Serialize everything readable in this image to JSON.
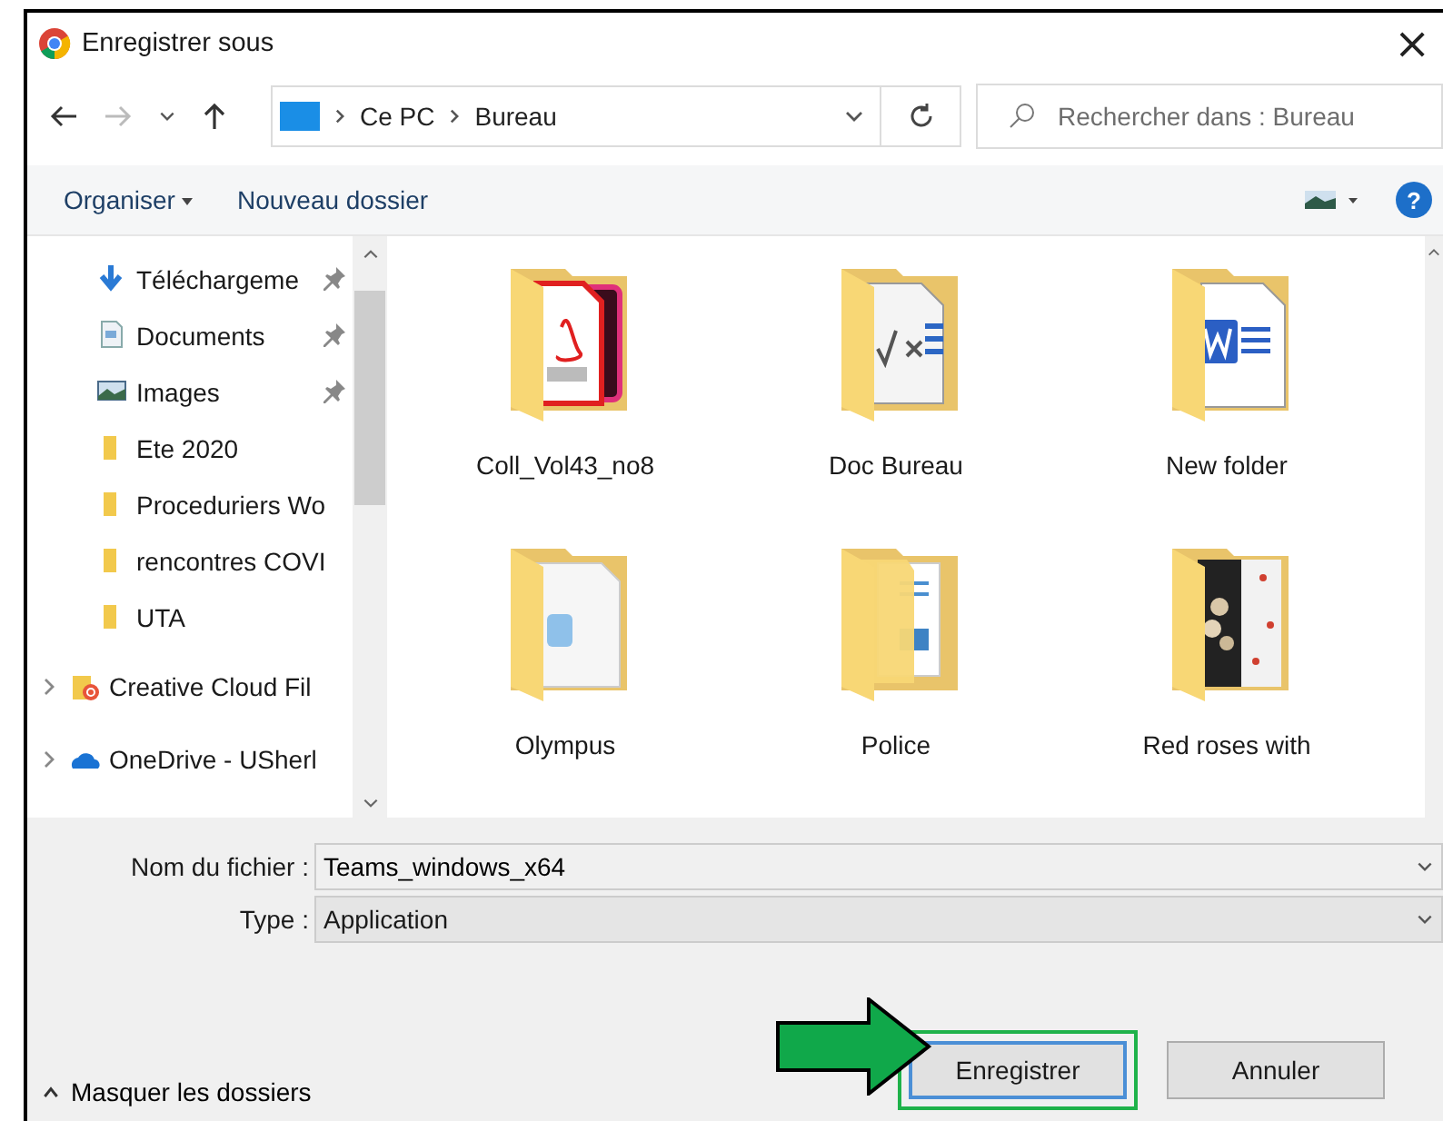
{
  "window": {
    "title": "Enregistrer sous",
    "close": "×"
  },
  "nav": {
    "breadcrumb": [
      "Ce PC",
      "Bureau"
    ],
    "search_placeholder": "Rechercher dans : Bureau"
  },
  "toolbar": {
    "organize": "Organiser",
    "new_folder": "Nouveau dossier",
    "help": "?"
  },
  "sidebar": {
    "items": [
      {
        "label": "Téléchargeme",
        "kind": "download",
        "pinned": true,
        "expandable": false
      },
      {
        "label": "Documents",
        "kind": "document",
        "pinned": true,
        "expandable": false
      },
      {
        "label": "Images",
        "kind": "images",
        "pinned": true,
        "expandable": false
      },
      {
        "label": "Ete 2020",
        "kind": "folder",
        "pinned": false,
        "expandable": false
      },
      {
        "label": "Proceduriers Wo",
        "kind": "folder",
        "pinned": false,
        "expandable": false
      },
      {
        "label": "rencontres COVI",
        "kind": "folder",
        "pinned": false,
        "expandable": false
      },
      {
        "label": "UTA",
        "kind": "folder",
        "pinned": false,
        "expandable": false
      },
      {
        "label": "Creative Cloud Fil",
        "kind": "cloudfolder",
        "pinned": false,
        "expandable": true
      },
      {
        "label": "OneDrive - USherl",
        "kind": "onedrive",
        "pinned": false,
        "expandable": true
      }
    ]
  },
  "files": [
    {
      "name": "Coll_Vol43_no8",
      "kind": "pdf"
    },
    {
      "name": "Doc Bureau",
      "kind": "math"
    },
    {
      "name": "New folder",
      "kind": "word"
    },
    {
      "name": "Olympus",
      "kind": "app"
    },
    {
      "name": "Police",
      "kind": "docs"
    },
    {
      "name": "Red roses with",
      "kind": "photo"
    }
  ],
  "form": {
    "filename_label": "Nom du fichier :",
    "filename": "Teams_windows_x64",
    "type_label": "Type :",
    "type": "Application"
  },
  "hide_folders": "Masquer les dossiers",
  "buttons": [
    {
      "label": "Enregistrer",
      "primary": true,
      "highlighted": true
    },
    {
      "label": "Annuler",
      "primary": false,
      "highlighted": false
    }
  ]
}
